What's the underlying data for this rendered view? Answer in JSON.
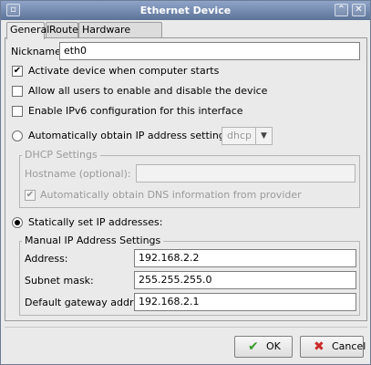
{
  "window": {
    "title": "Ethernet Device",
    "close_glyph": "✕",
    "up_glyph": "⌃"
  },
  "tabs": [
    {
      "label": "General"
    },
    {
      "label": "Route"
    },
    {
      "label": "Hardware Device"
    }
  ],
  "general": {
    "nickname_label": "Nickname:",
    "nickname_value": "eth0",
    "activate_label": "Activate device when computer starts",
    "activate_checked": true,
    "allow_users_label": "Allow all users to enable and disable the device",
    "allow_users_checked": false,
    "ipv6_label": "Enable IPv6 configuration for this interface",
    "ipv6_checked": false,
    "auto_ip_label": "Automatically obtain IP address settings with:",
    "auto_ip_selected": false,
    "auto_ip_method": "dhcp",
    "dhcp": {
      "title": "DHCP Settings",
      "hostname_label": "Hostname (optional):",
      "hostname_value": "",
      "dns_label": "Automatically obtain DNS information from provider",
      "dns_checked": true
    },
    "static_label": "Statically set IP addresses:",
    "static_selected": true,
    "manual": {
      "title": "Manual IP Address Settings",
      "address_label": "Address:",
      "address_value": "192.168.2.2",
      "subnet_label": "Subnet mask:",
      "subnet_value": "255.255.255.0",
      "gateway_label": "Default gateway address:",
      "gateway_value": "192.168.2.1"
    }
  },
  "buttons": {
    "ok_label": "OK",
    "ok_icon": "✔",
    "cancel_label": "Cancel",
    "cancel_icon": "✖"
  },
  "colors": {
    "titlebar": "#6f86ad",
    "ok_icon": "#3c9a2e",
    "cancel_icon": "#cc2b2b",
    "check_mark": "#000000"
  }
}
